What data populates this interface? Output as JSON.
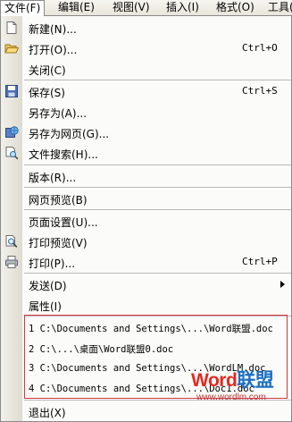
{
  "menubar": {
    "items": [
      {
        "label": "文件(F)"
      },
      {
        "label": "编辑(E)"
      },
      {
        "label": "视图(V)"
      },
      {
        "label": "插入(I)"
      },
      {
        "label": "格式(O)"
      },
      {
        "label": "工具(T)"
      }
    ]
  },
  "file_menu": {
    "new": {
      "label": "新建(N)..."
    },
    "open": {
      "label": "打开(O)...",
      "shortcut": "Ctrl+O"
    },
    "close": {
      "label": "关闭(C)"
    },
    "save": {
      "label": "保存(S)",
      "shortcut": "Ctrl+S"
    },
    "save_as": {
      "label": "另存为(A)..."
    },
    "save_as_web": {
      "label": "另存为网页(G)..."
    },
    "file_search": {
      "label": "文件搜索(H)..."
    },
    "versions": {
      "label": "版本(R)..."
    },
    "web_preview": {
      "label": "网页预览(B)"
    },
    "page_setup": {
      "label": "页面设置(U)..."
    },
    "print_preview": {
      "label": "打印预览(V)"
    },
    "print": {
      "label": "打印(P)...",
      "shortcut": "Ctrl+P"
    },
    "send_to": {
      "label": "发送(D)"
    },
    "properties": {
      "label": "属性(I)"
    },
    "recent_files": [
      {
        "label": "1 C:\\Documents and Settings\\...\\Word联盟.doc"
      },
      {
        "label": "2 C:\\...\\桌面\\Word联盟0.doc"
      },
      {
        "label": "3 C:\\Documents and Settings\\...\\WordLM.doc"
      },
      {
        "label": "4 C:\\Documents and Settings\\...\\Doc1.doc"
      }
    ],
    "exit": {
      "label": "退出(X)"
    }
  },
  "watermark": {
    "brand_word": "Word",
    "brand_cn": "联盟",
    "url": "www.wordlm.com"
  },
  "colors": {
    "highlight_box": "#d9363e",
    "watermark_red": "#e4291f",
    "watermark_blue": "#1d6fc1"
  }
}
